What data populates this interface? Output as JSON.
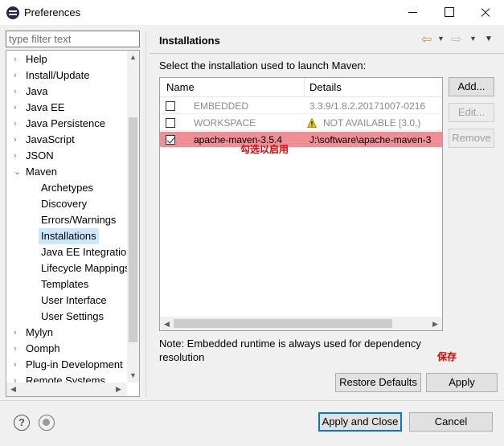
{
  "window": {
    "title": "Preferences"
  },
  "filter": {
    "placeholder": "type filter text"
  },
  "tree": {
    "items": [
      {
        "label": "Help",
        "level": 0,
        "arrow": "›"
      },
      {
        "label": "Install/Update",
        "level": 0,
        "arrow": "›"
      },
      {
        "label": "Java",
        "level": 0,
        "arrow": "›"
      },
      {
        "label": "Java EE",
        "level": 0,
        "arrow": "›"
      },
      {
        "label": "Java Persistence",
        "level": 0,
        "arrow": "›"
      },
      {
        "label": "JavaScript",
        "level": 0,
        "arrow": "›"
      },
      {
        "label": "JSON",
        "level": 0,
        "arrow": "›"
      },
      {
        "label": "Maven",
        "level": 0,
        "arrow": "⌄"
      },
      {
        "label": "Archetypes",
        "level": 1,
        "arrow": ""
      },
      {
        "label": "Discovery",
        "level": 1,
        "arrow": ""
      },
      {
        "label": "Errors/Warnings",
        "level": 1,
        "arrow": ""
      },
      {
        "label": "Installations",
        "level": 1,
        "arrow": ""
      },
      {
        "label": "Java EE Integration",
        "level": 1,
        "arrow": ""
      },
      {
        "label": "Lifecycle Mappings",
        "level": 1,
        "arrow": ""
      },
      {
        "label": "Templates",
        "level": 1,
        "arrow": ""
      },
      {
        "label": "User Interface",
        "level": 1,
        "arrow": ""
      },
      {
        "label": "User Settings",
        "level": 1,
        "arrow": ""
      },
      {
        "label": "Mylyn",
        "level": 0,
        "arrow": "›"
      },
      {
        "label": "Oomph",
        "level": 0,
        "arrow": "›"
      },
      {
        "label": "Plug-in Development",
        "level": 0,
        "arrow": "›"
      },
      {
        "label": "Remote Systems",
        "level": 0,
        "arrow": "›"
      }
    ],
    "selected_index": 11
  },
  "page": {
    "title": "Installations",
    "description": "Select the installation used to launch Maven:",
    "columns": [
      "Name",
      "Details"
    ],
    "rows": [
      {
        "checked": false,
        "name": "EMBEDDED",
        "details": "3.3.9/1.8.2.20171007-0216",
        "greyed": true,
        "warning": false,
        "selected": false
      },
      {
        "checked": false,
        "name": "WORKSPACE",
        "details": "NOT AVAILABLE [3.0,)",
        "greyed": true,
        "warning": true,
        "selected": false
      },
      {
        "checked": true,
        "name": "apache-maven-3.5.4",
        "details": "J:\\software\\apache-maven-3",
        "greyed": false,
        "warning": false,
        "selected": true
      }
    ],
    "annotation_check": "勾选以启用",
    "buttons": {
      "add": "Add...",
      "edit": "Edit...",
      "remove": "Remove"
    },
    "note": "Note: Embedded runtime is always used for dependency resolution",
    "annotation_save": "保存",
    "restore_defaults": "Restore Defaults",
    "apply": "Apply"
  },
  "footer": {
    "help_glyph": "?",
    "apply_and_close": "Apply and Close",
    "cancel": "Cancel"
  },
  "colors": {
    "selection_row": "#f08e96",
    "tree_selection": "#cce8ff",
    "annotation": "#e60000",
    "primary_border": "#0078d7"
  }
}
